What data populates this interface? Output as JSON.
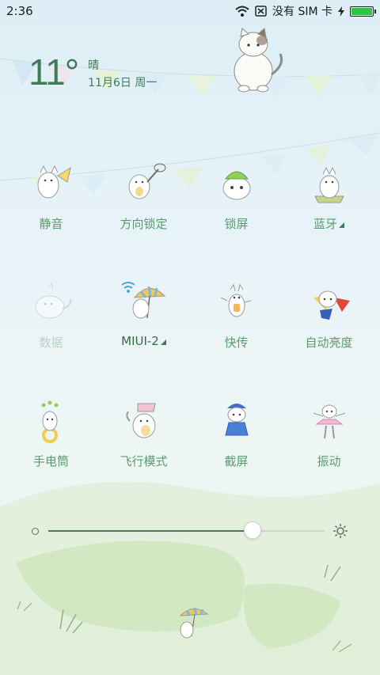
{
  "status_bar": {
    "time": "2:36",
    "carrier": "没有 SIM 卡",
    "battery_level": 1.0,
    "icons": [
      "wifi-icon",
      "sim-blocked-icon",
      "charging-bolt-icon",
      "battery-icon"
    ]
  },
  "weather": {
    "temperature": "11°",
    "condition": "晴",
    "date": "11月6日 周一"
  },
  "tiles": [
    {
      "id": "mute",
      "label": "静音",
      "state": "normal",
      "icon": "cat-megaphone-icon"
    },
    {
      "id": "rotation-lock",
      "label": "方向锁定",
      "state": "normal",
      "icon": "cat-net-icon"
    },
    {
      "id": "lock-screen",
      "label": "锁屏",
      "state": "normal",
      "icon": "cat-cap-icon"
    },
    {
      "id": "bluetooth",
      "label": "蓝牙",
      "state": "normal",
      "icon": "cat-sitting-icon",
      "has_menu": true
    },
    {
      "id": "data",
      "label": "数据",
      "state": "disabled",
      "icon": "cat-lying-icon"
    },
    {
      "id": "wifi",
      "label": "MIUI-2",
      "state": "active",
      "icon": "cat-umbrella-icon",
      "has_menu": true
    },
    {
      "id": "quick-share",
      "label": "快传",
      "state": "normal",
      "icon": "cat-running-icon"
    },
    {
      "id": "auto-brightness",
      "label": "自动亮度",
      "state": "normal",
      "icon": "cat-superhero-icon"
    },
    {
      "id": "flashlight",
      "label": "手电筒",
      "state": "normal",
      "icon": "cat-ring-icon"
    },
    {
      "id": "airplane-mode",
      "label": "飞行模式",
      "state": "normal",
      "icon": "cat-flag-icon"
    },
    {
      "id": "screenshot",
      "label": "截屏",
      "state": "normal",
      "icon": "cat-blue-hat-icon"
    },
    {
      "id": "vibrate",
      "label": "振动",
      "state": "normal",
      "icon": "cat-ballerina-icon"
    }
  ],
  "brightness": {
    "level": 0.74
  },
  "colors": {
    "accent": "#3f7b56",
    "label": "#5a9a6e",
    "disabled": "#b9d3c3",
    "battery": "#34c24a"
  }
}
